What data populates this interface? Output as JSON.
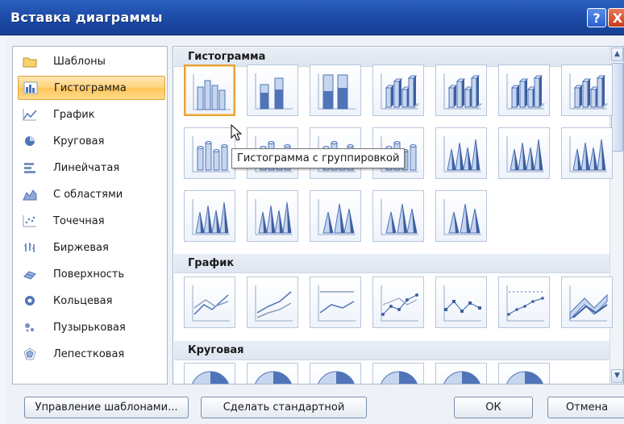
{
  "window": {
    "title": "Вставка диаграммы",
    "help_icon": "?",
    "close_icon": "X"
  },
  "categories": [
    {
      "label": "Шаблоны",
      "icon": "folder-icon",
      "selected": false
    },
    {
      "label": "Гистограмма",
      "icon": "column-chart-icon",
      "selected": true
    },
    {
      "label": "График",
      "icon": "line-chart-icon",
      "selected": false
    },
    {
      "label": "Круговая",
      "icon": "pie-chart-icon",
      "selected": false
    },
    {
      "label": "Линейчатая",
      "icon": "bar-chart-icon",
      "selected": false
    },
    {
      "label": "С областями",
      "icon": "area-chart-icon",
      "selected": false
    },
    {
      "label": "Точечная",
      "icon": "scatter-chart-icon",
      "selected": false
    },
    {
      "label": "Биржевая",
      "icon": "stock-chart-icon",
      "selected": false
    },
    {
      "label": "Поверхность",
      "icon": "surface-chart-icon",
      "selected": false
    },
    {
      "label": "Кольцевая",
      "icon": "doughnut-chart-icon",
      "selected": false
    },
    {
      "label": "Пузырьковая",
      "icon": "bubble-chart-icon",
      "selected": false
    },
    {
      "label": "Лепестковая",
      "icon": "radar-chart-icon",
      "selected": false
    }
  ],
  "sections": [
    {
      "title": "Гистограмма"
    },
    {
      "title": "График"
    },
    {
      "title": "Круговая"
    }
  ],
  "tooltip": "Гистограмма с группировкой",
  "buttons": {
    "manage_templates": "Управление шаблонами...",
    "set_default": "Сделать стандартной",
    "ok": "ОК",
    "cancel": "Отмена"
  },
  "colors": {
    "titlebar": "#1c4aa6",
    "selection": "#ffd27a",
    "chart_blue": "#4f74b8"
  }
}
